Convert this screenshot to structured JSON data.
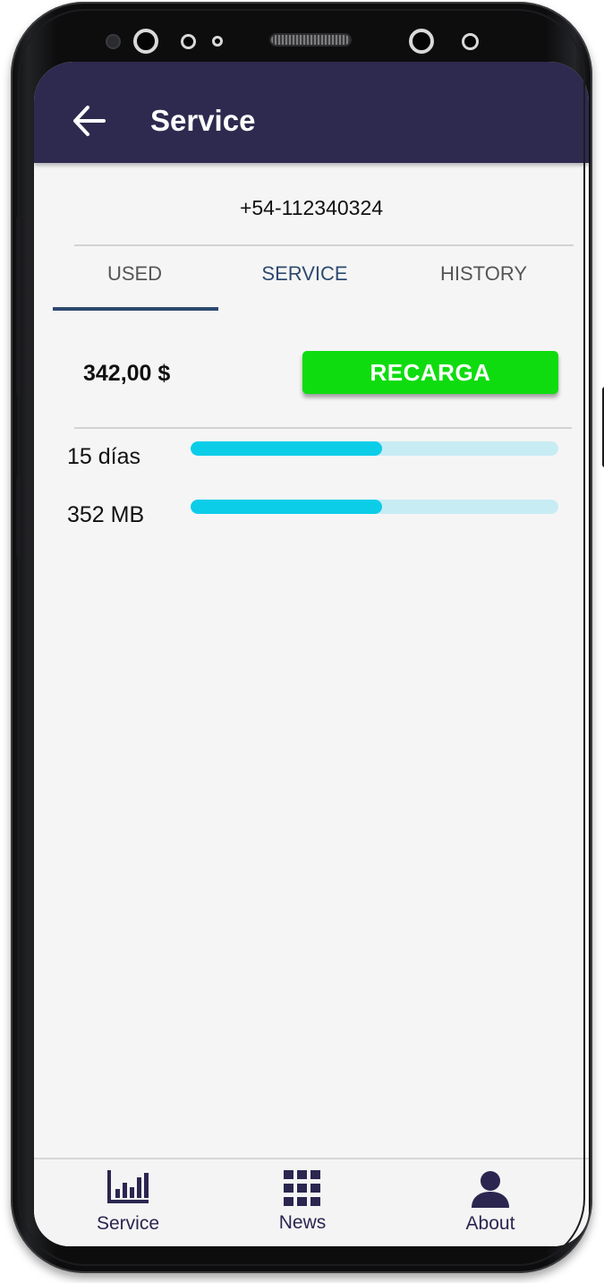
{
  "app_bar": {
    "title": "Service",
    "back_icon": "arrow-left-icon"
  },
  "account": {
    "phone_number": "+54-112340324"
  },
  "tabs": [
    {
      "label": "USED",
      "selected": true
    },
    {
      "label": "SERVICE",
      "selected": false
    },
    {
      "label": "HISTORY",
      "selected": false
    }
  ],
  "balance": {
    "amount": "342,00 $",
    "recharge_label": "RECARGA"
  },
  "usage": [
    {
      "label": "15 días",
      "progress": 0.52
    },
    {
      "label": "352 MB",
      "progress": 0.52
    }
  ],
  "bottom_nav": {
    "items": [
      {
        "label": "Service",
        "icon": "bar-chart-icon"
      },
      {
        "label": "News",
        "icon": "grid-icon"
      },
      {
        "label": "About",
        "icon": "person-icon"
      }
    ]
  },
  "colors": {
    "app_bar": "#2e2a4f",
    "accent": "#2d4a70",
    "recharge_button": "#0fdc0f",
    "progress_fill": "#0ccde8",
    "progress_track": "#c7ecf4",
    "nav_icon": "#2a2650"
  }
}
